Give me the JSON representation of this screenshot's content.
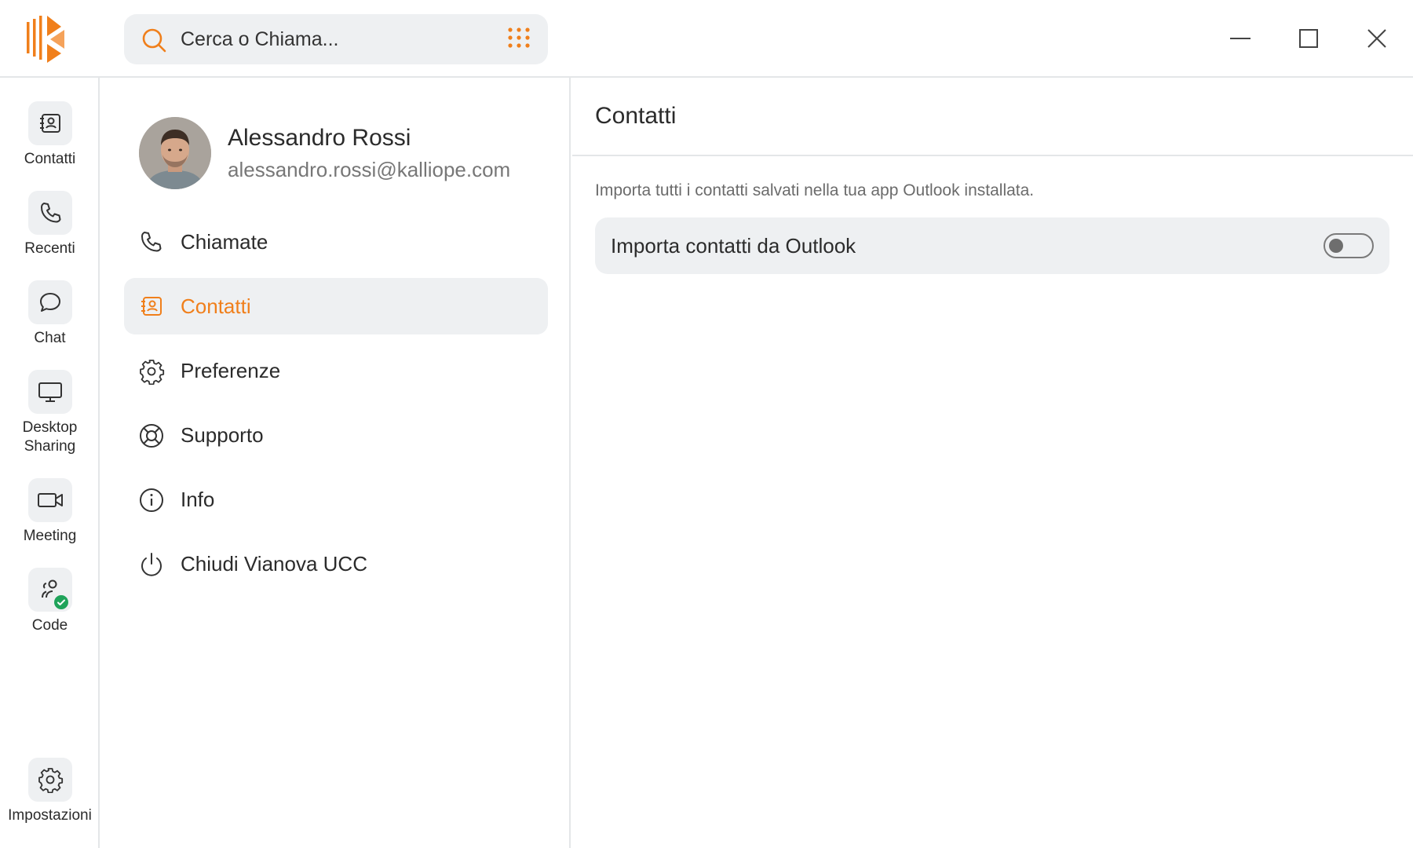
{
  "app": {
    "logo_icon": "kalliope-logo-icon",
    "accent_color": "#f07f1b"
  },
  "search": {
    "placeholder": "Cerca o Chiama...",
    "icon": "search-icon",
    "dialpad_icon": "dialpad-icon"
  },
  "window_controls": {
    "minimize_icon": "minimize-icon",
    "maximize_icon": "maximize-icon",
    "close_icon": "close-icon"
  },
  "rail": {
    "items": [
      {
        "label": "Contatti",
        "icon": "contact-book-icon"
      },
      {
        "label": "Recenti",
        "icon": "phone-icon"
      },
      {
        "label": "Chat",
        "icon": "chat-bubble-icon"
      },
      {
        "label": "Desktop\nSharing",
        "icon": "monitor-icon"
      },
      {
        "label": "Meeting",
        "icon": "video-camera-icon"
      },
      {
        "label": "Code",
        "icon": "users-queue-icon",
        "status": "available",
        "status_color": "#1fa35a"
      }
    ],
    "settings": {
      "label": "Impostazioni",
      "icon": "gear-icon"
    }
  },
  "profile": {
    "name": "Alessandro Rossi",
    "email": "alessandro.rossi@kalliope.com"
  },
  "menu": {
    "items": [
      {
        "label": "Chiamate",
        "icon": "phone-icon",
        "active": false
      },
      {
        "label": "Contatti",
        "icon": "contact-book-icon",
        "active": true
      },
      {
        "label": "Preferenze",
        "icon": "gear-icon",
        "active": false
      },
      {
        "label": "Supporto",
        "icon": "lifebuoy-icon",
        "active": false
      },
      {
        "label": "Info",
        "icon": "info-icon",
        "active": false
      },
      {
        "label": "Chiudi Vianova UCC",
        "icon": "power-icon",
        "active": false
      }
    ]
  },
  "panel": {
    "title": "Contatti",
    "description": "Importa tutti i contatti salvati nella tua app Outlook installata.",
    "toggle": {
      "label": "Importa contatti da Outlook",
      "enabled": false
    }
  }
}
